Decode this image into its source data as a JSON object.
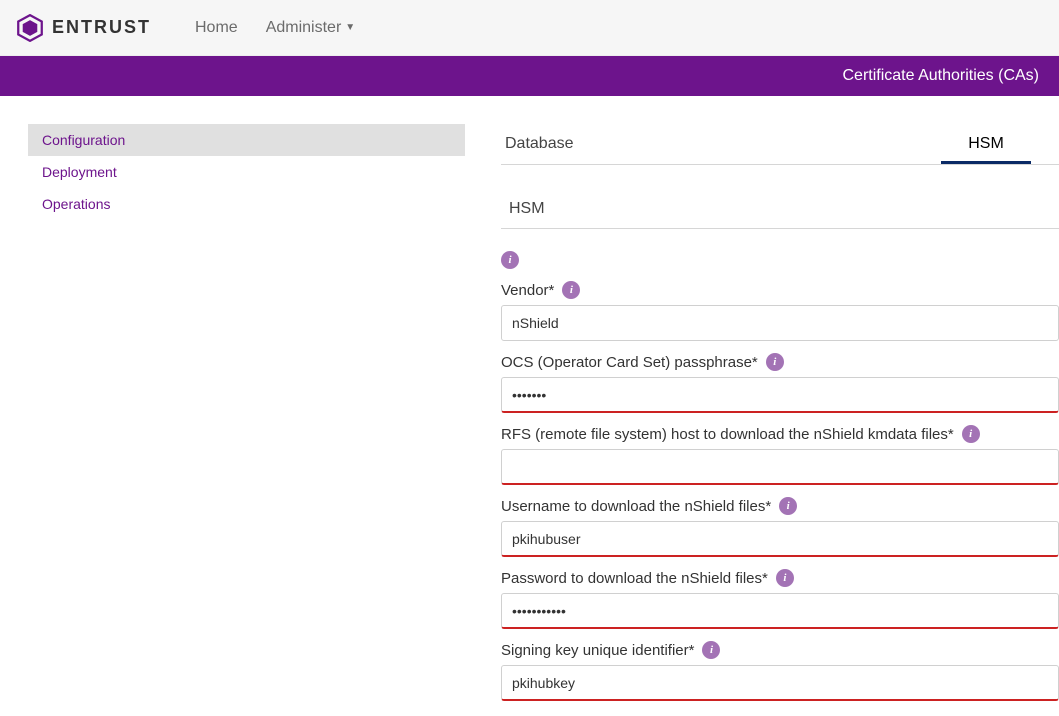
{
  "brand": "ENTRUST",
  "nav": {
    "home": "Home",
    "administer": "Administer"
  },
  "bar_title": "Certificate Authorities (CAs)",
  "sidebar": {
    "items": [
      {
        "label": "Configuration"
      },
      {
        "label": "Deployment"
      },
      {
        "label": "Operations"
      }
    ]
  },
  "tabs": {
    "database": "Database",
    "hsm": "HSM"
  },
  "section": {
    "title": "HSM"
  },
  "form": {
    "vendor": {
      "label": "Vendor*",
      "value": "nShield"
    },
    "ocs": {
      "label": "OCS (Operator Card Set) passphrase*",
      "value": "•••••••"
    },
    "rfs": {
      "label": "RFS (remote file system) host to download the nShield kmdata files*",
      "value": ""
    },
    "user": {
      "label": "Username to download the nShield files*",
      "value": "pkihubuser"
    },
    "pass": {
      "label": "Password to download the nShield files*",
      "value": "•••••••••••"
    },
    "key": {
      "label": "Signing key unique identifier*",
      "value": "pkihubkey"
    }
  }
}
